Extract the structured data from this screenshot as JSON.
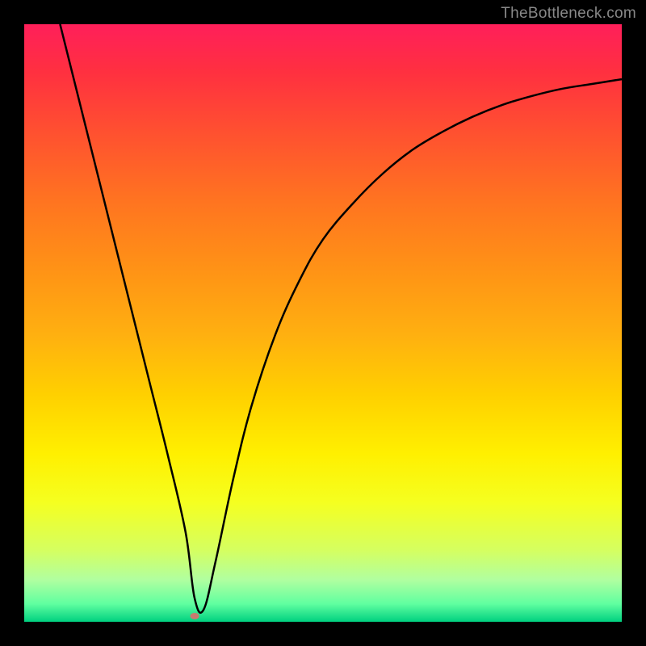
{
  "watermark": "TheBottleneck.com",
  "chart_data": {
    "type": "line",
    "title": "",
    "xlabel": "",
    "ylabel": "",
    "xlim": [
      0,
      100
    ],
    "ylim": [
      0,
      100
    ],
    "series": [
      {
        "name": "curve",
        "x": [
          6,
          10,
          14,
          18,
          21,
          24,
          27,
          28.5,
          30,
          32,
          35,
          38,
          42,
          46,
          50,
          55,
          60,
          65,
          70,
          75,
          80,
          85,
          90,
          95,
          100
        ],
        "y": [
          100,
          84,
          68,
          52,
          40,
          28,
          15,
          4,
          2,
          10,
          24,
          36,
          48,
          57,
          64,
          70,
          75,
          79,
          82,
          84.5,
          86.5,
          88,
          89.2,
          90,
          90.8
        ]
      }
    ],
    "marker": {
      "x": 28.5,
      "y": 1.0
    },
    "background_gradient": {
      "type": "vertical",
      "stops": [
        {
          "pos": 0,
          "color": "#ff1f5a"
        },
        {
          "pos": 18,
          "color": "#ff5030"
        },
        {
          "pos": 42,
          "color": "#ff9515"
        },
        {
          "pos": 62,
          "color": "#ffd000"
        },
        {
          "pos": 80,
          "color": "#f5ff20"
        },
        {
          "pos": 93,
          "color": "#b0ffa0"
        },
        {
          "pos": 100,
          "color": "#00d080"
        }
      ]
    }
  }
}
